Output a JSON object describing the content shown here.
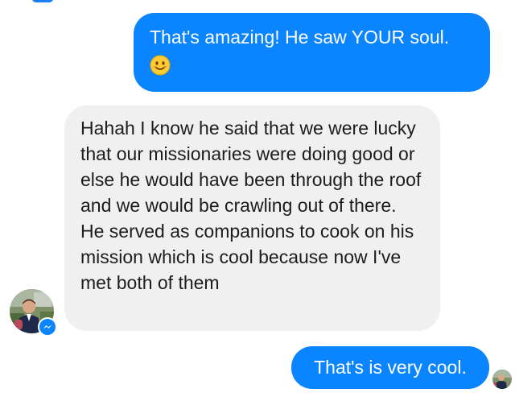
{
  "messages": [
    {
      "direction": "outgoing",
      "text": "That's amazing!  He saw YOUR soul.",
      "emoji": "smiling-face-emoji"
    },
    {
      "direction": "incoming",
      "text": "Hahah I know he said that we were lucky that our missionaries were doing good or else he would have been through the roof and we would be crawling out of there. He served as companions to cook on his mission which is cool because now I've met both of them"
    },
    {
      "direction": "outgoing",
      "text": "That's is very cool."
    }
  ],
  "icons": {
    "sender_avatar": "contact-avatar-photo",
    "messenger_badge": "messenger-bolt-icon",
    "read_receipt": "seen-avatar"
  },
  "colors": {
    "outgoing_bubble": "#0a84ff",
    "incoming_bubble": "#f1f0f0",
    "outgoing_text": "#ffffff",
    "incoming_text": "#1c1c1c"
  }
}
